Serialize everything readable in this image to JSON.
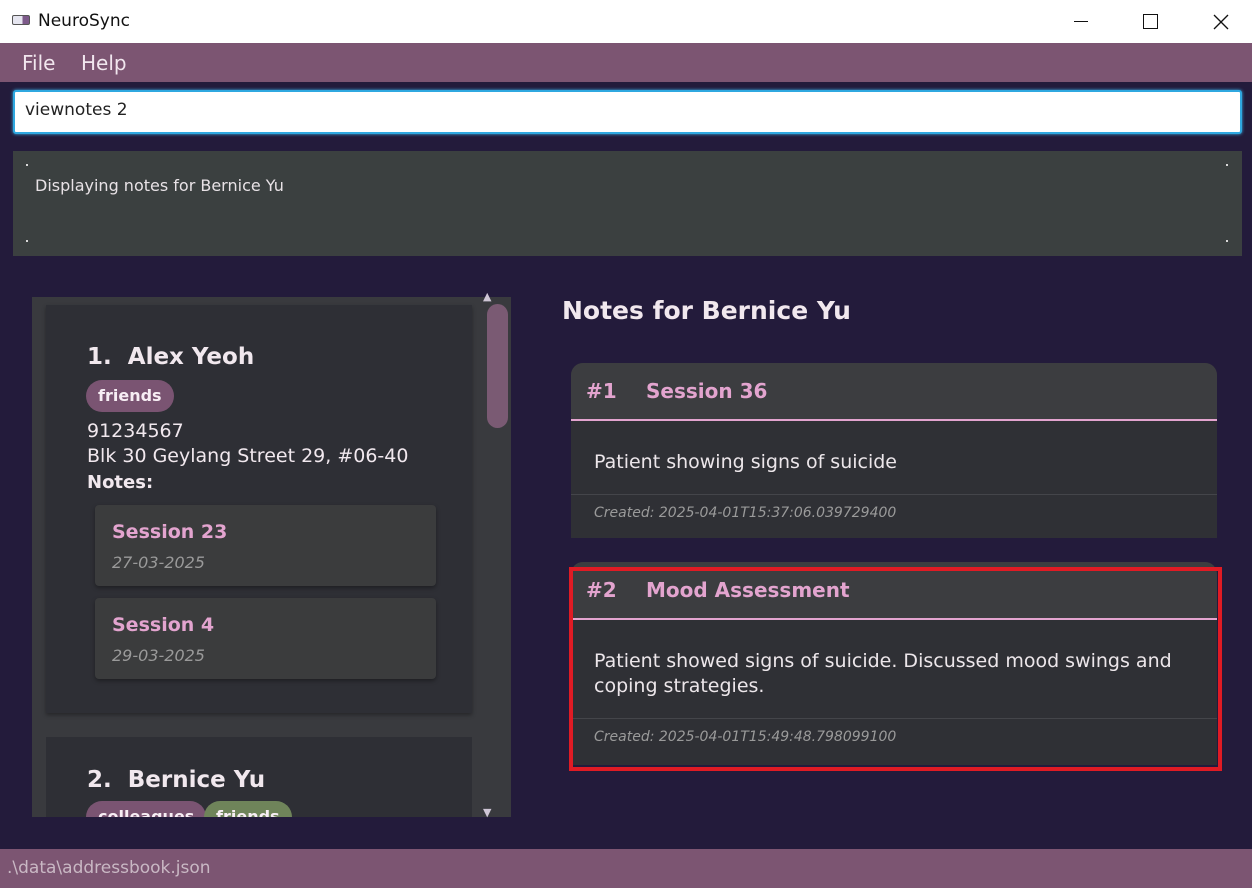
{
  "window": {
    "title": "NeuroSync"
  },
  "menu": {
    "file": "File",
    "help": "Help"
  },
  "command": {
    "value": "viewnotes 2",
    "placeholder": ""
  },
  "result": {
    "text": "Displaying notes for Bernice Yu"
  },
  "persons": [
    {
      "index": "1.",
      "name": "Alex Yeoh",
      "tags": [
        "friends"
      ],
      "phone": "91234567",
      "address": "Blk 30 Geylang Street 29, #06-40",
      "notes_label": "Notes:",
      "notes": [
        {
          "title": "Session 23",
          "date": "27-03-2025"
        },
        {
          "title": "Session 4",
          "date": "29-03-2025"
        }
      ]
    },
    {
      "index": "2.",
      "name": "Bernice Yu",
      "tags": [
        "colleagues",
        "friends"
      ]
    }
  ],
  "notes_panel": {
    "heading": "Notes for Bernice Yu",
    "notes": [
      {
        "num": "#1",
        "title": "Session 36",
        "body": "Patient showing signs of suicide",
        "created": "Created: 2025-04-01T15:37:06.039729400"
      },
      {
        "num": "#2",
        "title": "Mood Assessment",
        "body": "Patient showed signs of suicide. Discussed mood swings and coping strategies.",
        "created": "Created: 2025-04-01T15:49:48.798099100"
      }
    ]
  },
  "status": {
    "path": ".\\data\\addressbook.json"
  },
  "colors": {
    "accent": "#7c5572",
    "note_title": "#e3a4cf",
    "highlight": "#e01b24",
    "background": "#231b3b"
  }
}
